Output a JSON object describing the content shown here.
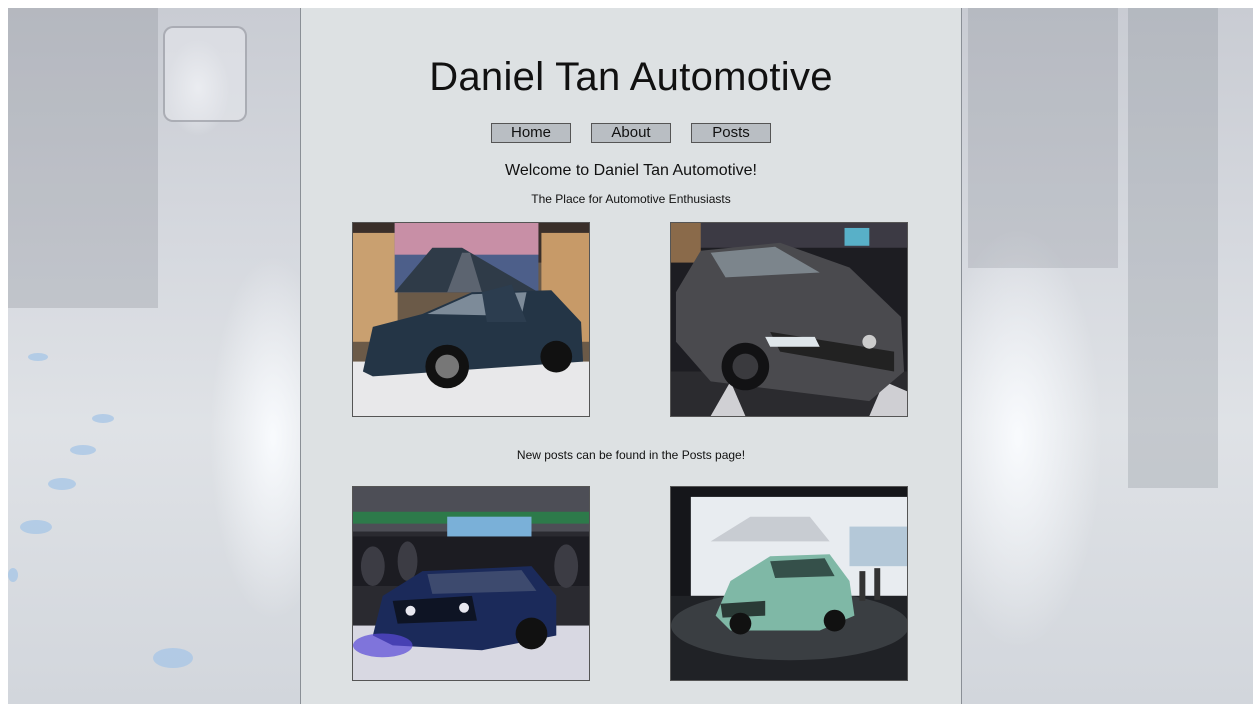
{
  "site": {
    "title": "Daniel Tan Automotive"
  },
  "nav": {
    "items": [
      {
        "label": "Home"
      },
      {
        "label": "About"
      },
      {
        "label": "Posts"
      }
    ]
  },
  "intro": {
    "welcome": "Welcome to Daniel Tan Automotive!",
    "tagline": "The Place for Automotive Enthusiasts"
  },
  "notice": "New posts can be found in the Posts page!",
  "colors": {
    "panel": "#dde1e3",
    "button": "#b9bec3"
  }
}
